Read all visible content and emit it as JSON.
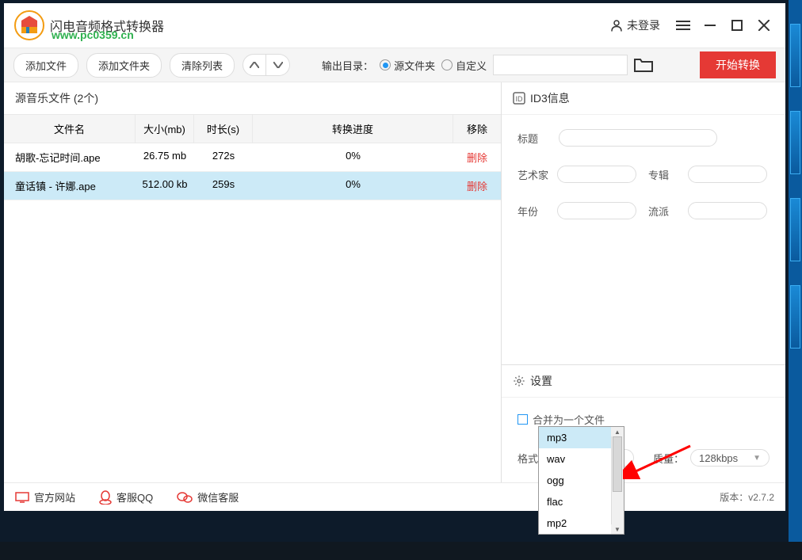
{
  "app": {
    "title": "闪电音频格式转换器",
    "watermark": "www.pc0359.cn"
  },
  "titlebar": {
    "login": "未登录"
  },
  "toolbar": {
    "add_file": "添加文件",
    "add_folder": "添加文件夹",
    "clear_list": "清除列表",
    "output_label": "输出目录：",
    "opt_source": "源文件夹",
    "opt_custom": "自定义",
    "convert": "开始转换"
  },
  "file_panel": {
    "header": "源音乐文件 (2个)",
    "cols": {
      "name": "文件名",
      "size": "大小(mb)",
      "duration": "时长(s)",
      "progress": "转换进度",
      "remove": "移除"
    },
    "rows": [
      {
        "name": "胡歌-忘记时间.ape",
        "size": "26.75 mb",
        "duration": "272s",
        "progress": "0%",
        "remove": "删除"
      },
      {
        "name": "童话镇 - 许娜.ape",
        "size": "512.00 kb",
        "duration": "259s",
        "progress": "0%",
        "remove": "删除"
      }
    ]
  },
  "id3": {
    "header": "ID3信息",
    "title": "标题",
    "artist": "艺术家",
    "album": "专辑",
    "year": "年份",
    "genre": "流派"
  },
  "settings": {
    "header": "设置",
    "merge": "合并为一个文件",
    "format_label": "格式：",
    "format_value": "mp3",
    "quality_label": "质量：",
    "quality_value": "128kbps",
    "format_options": [
      "mp3",
      "wav",
      "ogg",
      "flac",
      "mp2"
    ]
  },
  "footer": {
    "site": "官方网站",
    "qq": "客服QQ",
    "wechat": "微信客服",
    "version": "版本：v2.7.2"
  }
}
